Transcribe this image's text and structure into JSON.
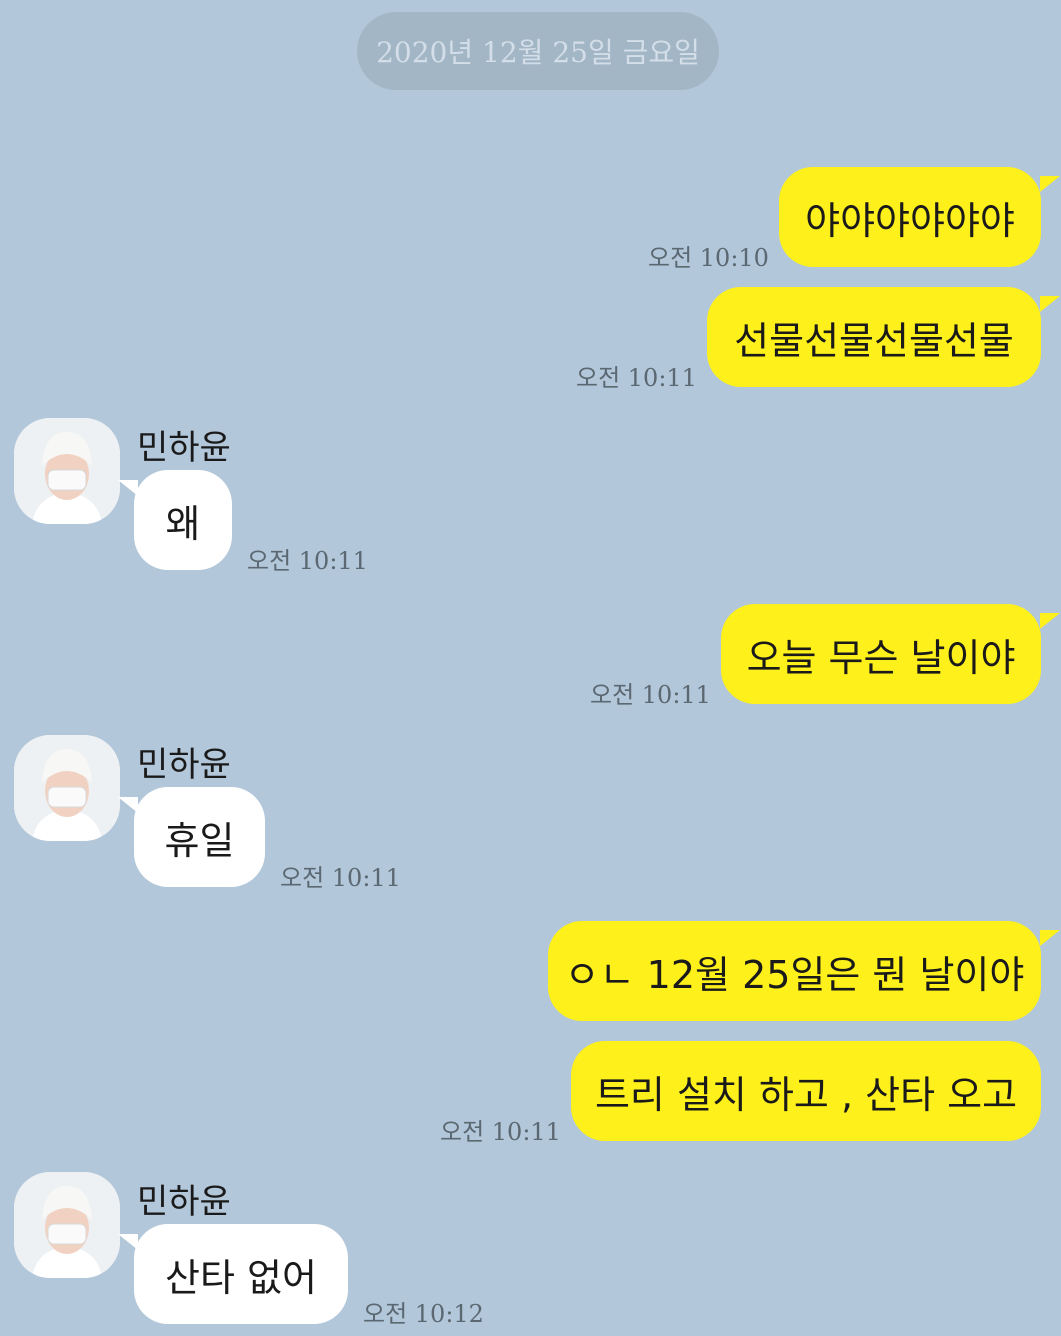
{
  "date_divider": "2020년 12월 25일 금요일",
  "contact": {
    "name": "민하윤",
    "avatar_icon": "profile-photo-person-white-hat-mask"
  },
  "colors": {
    "background": "#b2c7d9",
    "my_bubble": "#fef01b",
    "their_bubble": "#ffffff"
  },
  "messages": [
    {
      "sender": "me",
      "text": "야야야야야야",
      "time": "오전 10:10"
    },
    {
      "sender": "me",
      "text": "선물선물선물선물",
      "time": "오전 10:11"
    },
    {
      "sender": "them",
      "text": "왜",
      "time": "오전 10:11"
    },
    {
      "sender": "me",
      "text": "오늘 무슨 날이야",
      "time": "오전 10:11"
    },
    {
      "sender": "them",
      "text": "휴일",
      "time": "오전 10:11"
    },
    {
      "sender": "me",
      "text": "ㅇㄴ 12월 25일은 뭔 날이야",
      "time": ""
    },
    {
      "sender": "me",
      "text": "트리 설치 하고 , 산타 오고",
      "time": "오전 10:11"
    },
    {
      "sender": "them",
      "text": "산타 없어",
      "time": "오전 10:12"
    }
  ]
}
